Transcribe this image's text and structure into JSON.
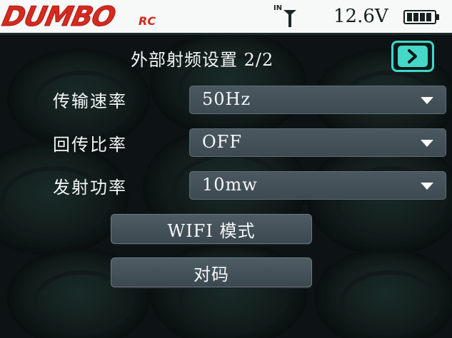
{
  "status": {
    "logo_text": "DUMBO",
    "logo_sub": "RC",
    "signal_label": "IN",
    "voltage": "12.6V",
    "battery_level": 1.0
  },
  "page": {
    "title": "外部射频设置 2/2"
  },
  "settings": [
    {
      "label": "传输速率",
      "value": "50Hz"
    },
    {
      "label": "回传比率",
      "value": "OFF"
    },
    {
      "label": "发射功率",
      "value": "10mw"
    }
  ],
  "buttons": {
    "wifi": "WIFI 模式",
    "bind": "对码"
  },
  "colors": {
    "accent": "#45d8c8",
    "logo": "#d42a1f",
    "control_bg": "#46535b",
    "background": "#0d1214"
  }
}
